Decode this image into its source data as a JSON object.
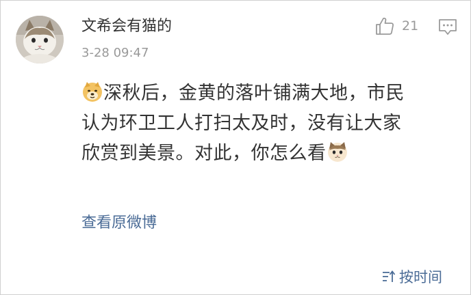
{
  "comment": {
    "user": {
      "name": "文希会有猫的",
      "avatar_icon": "cat-avatar"
    },
    "timestamp": "3-28 09:47",
    "likes": {
      "icon": "thumbs-up-icon",
      "count": "21"
    },
    "reply_icon": "comment-bubble-icon",
    "content": {
      "lines": [
        "深秋后，金黄的落叶铺满大地，市民",
        "认为环卫工人打扫太及时，没有让大家",
        "欣赏到美景。对此，你怎么看"
      ],
      "emoji_start": "doge-emoji",
      "emoji_end": "cat-emoji"
    },
    "view_original": "查看原微博"
  },
  "footer": {
    "sort_label": "按时间",
    "sort_icon": "sort-icon"
  },
  "colors": {
    "text": "#333333",
    "muted": "#999999",
    "link": "#4a6b96"
  }
}
